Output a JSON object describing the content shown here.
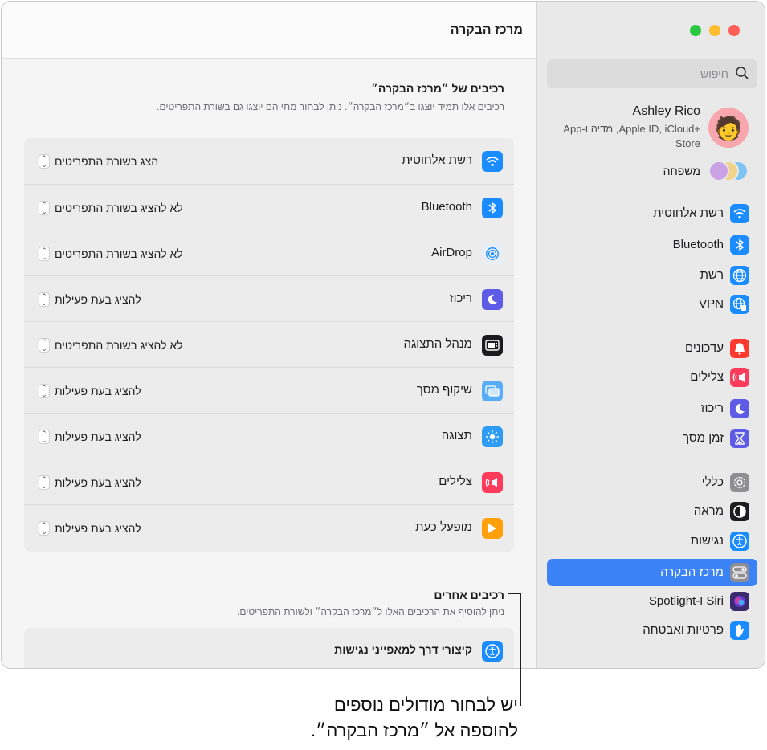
{
  "page_title": "מרכז הבקרה",
  "controls_section": {
    "title": "רכיבים של ״מרכז הבקרה״",
    "subtitle": "רכיבים אלו תמיד יוצגו ב״מרכז הבקרה״. ניתן לבחור מתי הם יוצגו גם בשורת התפריטים.",
    "rows": [
      {
        "label": "רשת אלחוטית",
        "value": "הצג בשורת התפריטים",
        "icon": "wifi-icon",
        "color": "#1a8cff"
      },
      {
        "label": "Bluetooth",
        "value": "לא להציג בשורת התפריטים",
        "icon": "bluetooth-icon",
        "color": "#1a8cff"
      },
      {
        "label": "AirDrop",
        "value": "לא להציג בשורת התפריטים",
        "icon": "airdrop-icon",
        "color": "#e8eef8"
      },
      {
        "label": "ריכוז",
        "value": "להציג בעת פעילות",
        "icon": "focus-moon-icon",
        "color": "#5e5ce6"
      },
      {
        "label": "מנהל התצוגה",
        "value": "לא להציג בשורת התפריטים",
        "icon": "stage-manager-icon",
        "color": "#1c1c1e"
      },
      {
        "label": "שיקוף מסך",
        "value": "להציג בעת פעילות",
        "icon": "screen-mirroring-icon",
        "color": "#59adf7"
      },
      {
        "label": "תצוגה",
        "value": "להציג בעת פעילות",
        "icon": "display-brightness-icon",
        "color": "#2e9cf5"
      },
      {
        "label": "צלילים",
        "value": "להציג בעת פעילות",
        "icon": "sound-icon",
        "color": "#ff3b5c"
      },
      {
        "label": "מופעל כעת",
        "value": "להציג בעת פעילות",
        "icon": "now-playing-icon",
        "color": "#ff9f0a"
      }
    ]
  },
  "other_section": {
    "title": "רכיבים אחרים",
    "subtitle": "ניתן להוסיף את הרכיבים האלו ל״מרכז הבקרה״ ולשורת התפריטים.",
    "rows": [
      {
        "label": "קיצורי דרך למאפייני נגישות",
        "icon": "accessibility-icon",
        "color": "#1a8cff"
      }
    ]
  },
  "sidebar": {
    "search_placeholder": "חיפוש",
    "profile": {
      "name": "Ashley Rico",
      "subtitle": "Apple ID, iCloud+‎, מדיה ו-App Store"
    },
    "family_label": "משפחה",
    "items": [
      {
        "label": "רשת אלחוטית",
        "icon": "wifi-icon",
        "color": "#1a8cff"
      },
      {
        "label": "Bluetooth",
        "icon": "bluetooth-icon",
        "color": "#1a8cff"
      },
      {
        "label": "רשת",
        "icon": "globe-icon",
        "color": "#1a8cff"
      },
      {
        "label": "VPN",
        "icon": "vpn-globe-icon",
        "color": "#1a8cff"
      },
      {
        "label": "עדכונים",
        "icon": "notifications-bell-icon",
        "color": "#ff3b30"
      },
      {
        "label": "צלילים",
        "icon": "sound-icon",
        "color": "#ff3b5c"
      },
      {
        "label": "ריכוז",
        "icon": "focus-moon-icon",
        "color": "#5e5ce6"
      },
      {
        "label": "זמן מסך",
        "icon": "hourglass-icon",
        "color": "#5e5ce6"
      },
      {
        "label": "כללי",
        "icon": "gear-icon",
        "color": "#8e8e93"
      },
      {
        "label": "מראה",
        "icon": "appearance-icon",
        "color": "#1c1c1e"
      },
      {
        "label": "נגישות",
        "icon": "accessibility-icon",
        "color": "#1a8cff"
      },
      {
        "label": "מרכז הבקרה",
        "icon": "control-center-icon",
        "color": "#8e8e93",
        "selected": true
      },
      {
        "label": "Siri ו-Spotlight",
        "icon": "siri-icon",
        "color": "#3a2a6e"
      },
      {
        "label": "פרטיות ואבטחה",
        "icon": "hand-privacy-icon",
        "color": "#1a8cff"
      }
    ]
  },
  "callout": {
    "line1": "יש לבחור מודולים נוספים",
    "line2": "להוספה אל ״מרכז הבקרה״."
  }
}
